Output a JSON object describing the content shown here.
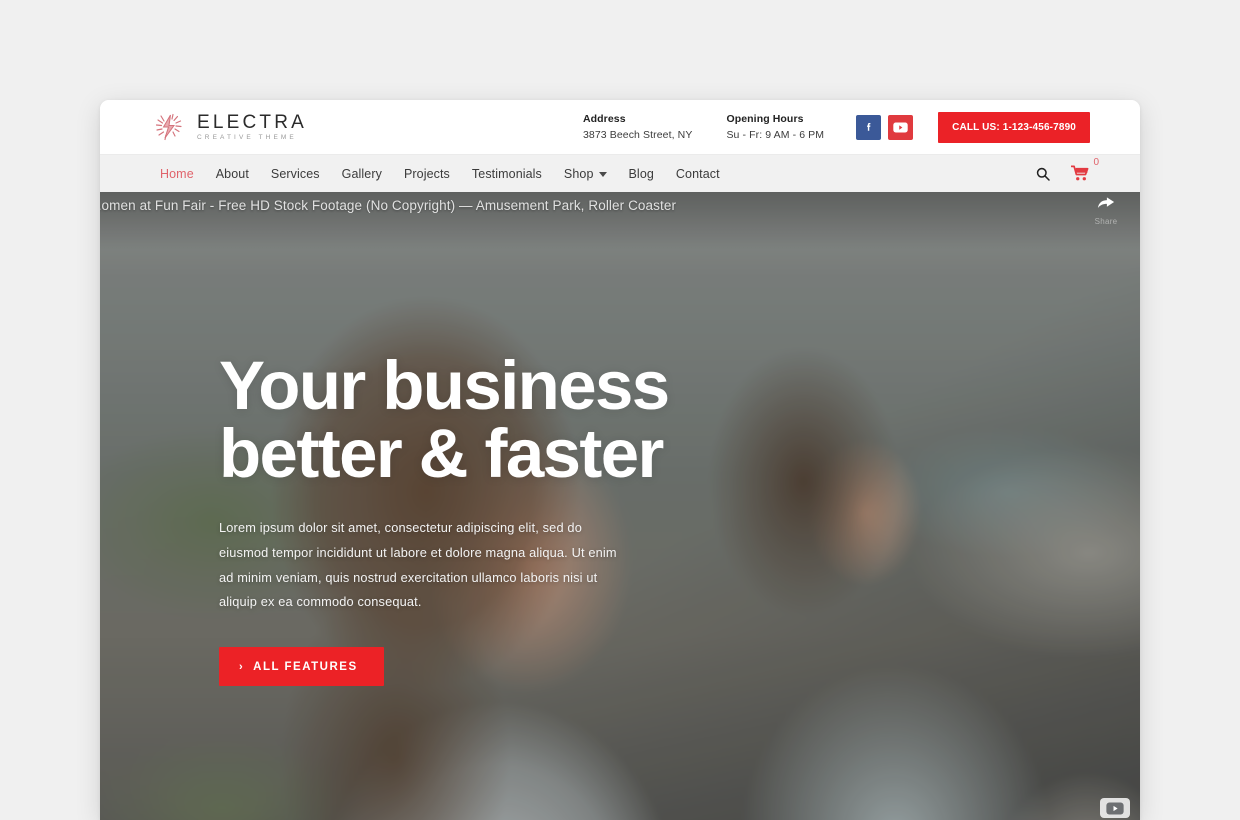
{
  "brand": {
    "name": "ELECTRA",
    "tagline": "CREATIVE THEME",
    "logo_icon": "electric-spark-logo-icon",
    "accent_color": "#e0636b"
  },
  "header": {
    "address": {
      "title": "Address",
      "value": "3873 Beech Street, NY"
    },
    "hours": {
      "title": "Opening Hours",
      "value": "Su - Fr: 9 AM - 6 PM"
    },
    "social": [
      {
        "name": "facebook-icon",
        "glyph": "f",
        "color": "#3b5998"
      },
      {
        "name": "youtube-icon",
        "glyph": "▶",
        "color": "#e03a3e"
      }
    ],
    "call_button": {
      "label": "CALL US: 1-123-456-7890",
      "color": "#eb2227"
    }
  },
  "nav": {
    "items": [
      {
        "label": "Home",
        "active": true,
        "has_dropdown": false
      },
      {
        "label": "About",
        "active": false,
        "has_dropdown": false
      },
      {
        "label": "Services",
        "active": false,
        "has_dropdown": false
      },
      {
        "label": "Gallery",
        "active": false,
        "has_dropdown": false
      },
      {
        "label": "Projects",
        "active": false,
        "has_dropdown": false
      },
      {
        "label": "Testimonials",
        "active": false,
        "has_dropdown": false
      },
      {
        "label": "Shop",
        "active": false,
        "has_dropdown": true
      },
      {
        "label": "Blog",
        "active": false,
        "has_dropdown": false
      },
      {
        "label": "Contact",
        "active": false,
        "has_dropdown": false
      }
    ],
    "search_icon": "search-icon",
    "cart_icon": "shopping-cart-icon",
    "cart_count": "0"
  },
  "video_player": {
    "title": "...omen at Fun Fair - Free HD Stock Footage (No Copyright) — Amusement Park, Roller Coaster",
    "share_label": "Share",
    "share_icon": "share-arrow-icon",
    "watermark_icon": "youtube-watermark-icon"
  },
  "hero": {
    "title_line1": "Your business",
    "title_line2": "better & faster",
    "paragraph": "Lorem ipsum dolor sit amet, consectetur adipiscing elit, sed do eiusmod tempor incididunt ut labore et dolore magna aliqua. Ut enim ad minim veniam, quis nostrud exercitation ullamco laboris nisi ut aliquip ex ea commodo consequat.",
    "cta": {
      "label": "ALL  FEATURES",
      "chevron": "›",
      "color": "#ec2226"
    }
  }
}
